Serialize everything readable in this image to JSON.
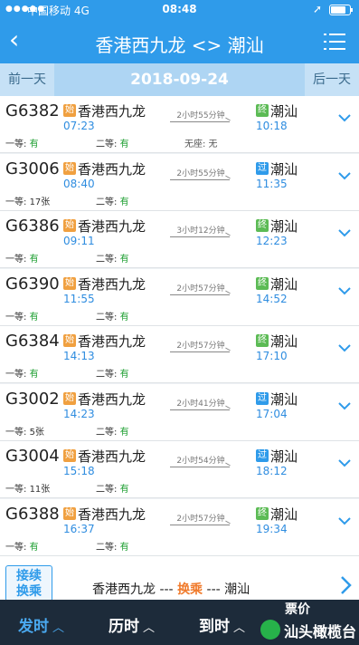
{
  "status_bar": {
    "carrier": "中国移动",
    "network": "4G",
    "time": "08:48"
  },
  "header": {
    "title": "香港西九龙 <> 潮汕"
  },
  "date_bar": {
    "prev_label": "前一天",
    "date": "2018-09-24",
    "next_label": "后一天"
  },
  "trains": [
    {
      "no": "G6382",
      "from_badge": "始",
      "from": "香港西九龙",
      "dep": "07:23",
      "duration": "2小时55分钟",
      "to_badge": "终",
      "to_type": "end",
      "to": "潮汕",
      "arr": "10:18",
      "first_label": "一等:",
      "first": "有",
      "second_label": "二等:",
      "second": "有",
      "noseat": "无座: 无"
    },
    {
      "no": "G3006",
      "from_badge": "始",
      "from": "香港西九龙",
      "dep": "08:40",
      "duration": "2小时55分钟",
      "to_badge": "过",
      "to_type": "pass",
      "to": "潮汕",
      "arr": "11:35",
      "first_label": "一等:",
      "first": "17张",
      "second_label": "二等:",
      "second": "有",
      "noseat": ""
    },
    {
      "no": "G6386",
      "from_badge": "始",
      "from": "香港西九龙",
      "dep": "09:11",
      "duration": "3小时12分钟",
      "to_badge": "终",
      "to_type": "end",
      "to": "潮汕",
      "arr": "12:23",
      "first_label": "一等:",
      "first": "有",
      "second_label": "二等:",
      "second": "有",
      "noseat": ""
    },
    {
      "no": "G6390",
      "from_badge": "始",
      "from": "香港西九龙",
      "dep": "11:55",
      "duration": "2小时57分钟",
      "to_badge": "终",
      "to_type": "end",
      "to": "潮汕",
      "arr": "14:52",
      "first_label": "一等:",
      "first": "有",
      "second_label": "二等:",
      "second": "有",
      "noseat": ""
    },
    {
      "no": "G6384",
      "from_badge": "始",
      "from": "香港西九龙",
      "dep": "14:13",
      "duration": "2小时57分钟",
      "to_badge": "终",
      "to_type": "end",
      "to": "潮汕",
      "arr": "17:10",
      "first_label": "一等:",
      "first": "有",
      "second_label": "二等:",
      "second": "有",
      "noseat": ""
    },
    {
      "no": "G3002",
      "from_badge": "始",
      "from": "香港西九龙",
      "dep": "14:23",
      "duration": "2小时41分钟",
      "to_badge": "过",
      "to_type": "pass",
      "to": "潮汕",
      "arr": "17:04",
      "first_label": "一等:",
      "first": "5张",
      "second_label": "二等:",
      "second": "有",
      "noseat": ""
    },
    {
      "no": "G3004",
      "from_badge": "始",
      "from": "香港西九龙",
      "dep": "15:18",
      "duration": "2小时54分钟",
      "to_badge": "过",
      "to_type": "pass",
      "to": "潮汕",
      "arr": "18:12",
      "first_label": "一等:",
      "first": "11张",
      "second_label": "二等:",
      "second": "有",
      "noseat": ""
    },
    {
      "no": "G6388",
      "from_badge": "始",
      "from": "香港西九龙",
      "dep": "16:37",
      "duration": "2小时57分钟",
      "to_badge": "终",
      "to_type": "end",
      "to": "潮汕",
      "arr": "19:34",
      "first_label": "一等:",
      "first": "有",
      "second_label": "二等:",
      "second": "有",
      "noseat": ""
    }
  ],
  "transfer": {
    "button_line1": "接续",
    "button_line2": "换乘",
    "from": "香港西九龙",
    "sep1": " --- ",
    "middle": "换乘",
    "sep2": " --- ",
    "to": "潮汕"
  },
  "bottom_bar": {
    "depart": "发时",
    "duration": "历时",
    "arrive": "到时",
    "price": "票价",
    "watermark": "汕头橄榄台"
  },
  "colors": {
    "primary": "#2f9bea",
    "available": "#1a9d2e",
    "time": "#2f8de0",
    "start_badge": "#f0a040",
    "end_badge": "#5cbb55",
    "transfer_highlight": "#f07a2b",
    "bottom_bar": "#1d2b3a"
  }
}
